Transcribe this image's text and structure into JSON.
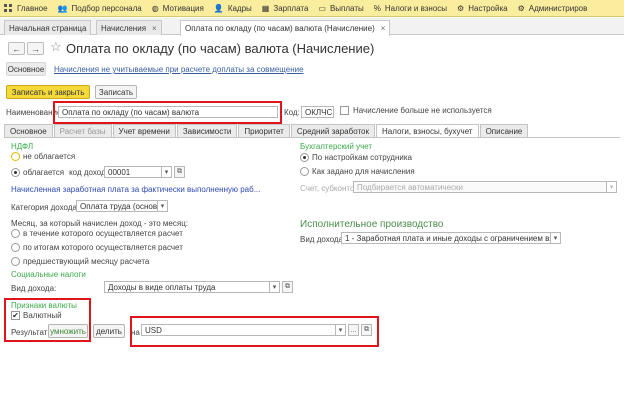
{
  "menu": [
    {
      "label": "Главное",
      "icon": "grid-icon"
    },
    {
      "label": "Подбор персонала",
      "icon": "people-icon"
    },
    {
      "label": "Мотивация",
      "icon": "coins-icon"
    },
    {
      "label": "Кадры",
      "icon": "person-icon"
    },
    {
      "label": "Зарплата",
      "icon": "calculator-icon"
    },
    {
      "label": "Выплаты",
      "icon": "wallet-icon"
    },
    {
      "label": "Налоги и взносы",
      "icon": "percent-icon"
    },
    {
      "label": "Настройка",
      "icon": "gear-icon"
    },
    {
      "label": "Администриров",
      "icon": "admin-icon"
    }
  ],
  "tabs": [
    {
      "label": "Начальная страница"
    },
    {
      "label": "Начисления"
    },
    {
      "label": "Оплата по окладу (по часам) валюта (Начисление)"
    }
  ],
  "header": {
    "title": "Оплата по окладу (по часам) валюта (Начисление)",
    "main_tab": "Основное",
    "link": "Начисления не учитываемые при расчете доплаты за совмещение"
  },
  "toolbar": {
    "save_close": "Записать и закрыть",
    "save": "Записать"
  },
  "fields": {
    "name_label": "Наименование:",
    "name_value": "Оплата по окладу (по часам) валюта",
    "code_label": "Код:",
    "code_value": "ОКЛЧС",
    "unused_label": "Начисление больше не используется"
  },
  "form_tabs": [
    {
      "label": "Основное",
      "state": "normal"
    },
    {
      "label": "Расчет базы",
      "state": "disabled"
    },
    {
      "label": "Учет времени",
      "state": "normal"
    },
    {
      "label": "Зависимости",
      "state": "normal"
    },
    {
      "label": "Приоритет",
      "state": "normal"
    },
    {
      "label": "Средний заработок",
      "state": "normal"
    },
    {
      "label": "Налоги, взносы, бухучет",
      "state": "active"
    },
    {
      "label": "Описание",
      "state": "normal"
    }
  ],
  "ndfl": {
    "heading": "НДФЛ",
    "not_taxed": "не облагается",
    "taxed": "облагается",
    "income_code_label": "код дохода:",
    "income_code": "00001",
    "salary_link": "Начисленная заработная плата за фактически выполненную раб...",
    "category_label": "Категория дохода:",
    "category_value": "Оплата труда (основная н",
    "month_label": "Месяц, за который начислен доход - это месяц:",
    "month_options": [
      "в течение которого осуществляется расчет",
      "по итогам которого осуществляется расчет",
      "предшествующий месяцу расчета"
    ]
  },
  "social": {
    "heading": "Социальные налоги",
    "income_type_label": "Вид дохода:",
    "income_type_value": "Доходы в виде оплаты труда"
  },
  "currency": {
    "heading": "Признаки валюты",
    "checkbox_label": "Валютный",
    "result_label": "Результат:",
    "multiply_btn": "умножить",
    "divide_btn": "делить",
    "on_label": "на",
    "currency_value": "USD"
  },
  "accounting": {
    "heading": "Бухгалтерский учет",
    "option1": "По настройкам сотрудника",
    "option2": "Как задано для начисления",
    "account_label": "Счет, субконто:",
    "account_placeholder": "Подбирается автоматически"
  },
  "enforcement": {
    "heading": "Исполнительное производство",
    "income_type_label": "Вид дохода:",
    "income_type_value": "1 - Заработная плата и иные доходы с ограничением взыскания"
  }
}
